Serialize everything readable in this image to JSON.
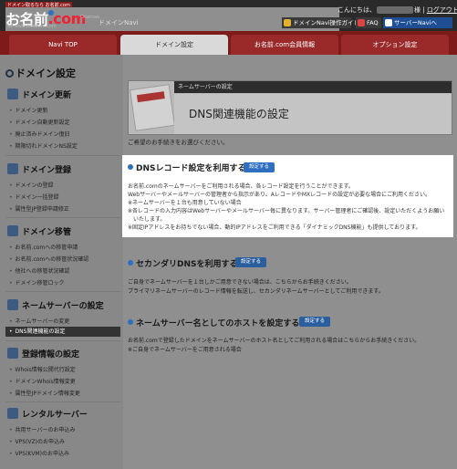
{
  "header": {
    "logo_tag": "ドメイン取るなら お名前.com",
    "logo_text": "お名前",
    "logo_suffix": ".com",
    "logo_url": "by www.onamae.com",
    "logo_tm": "Onamae",
    "navi_title": "ドメインNavi",
    "greeting": "こんにちは、",
    "greeting_suffix": "様",
    "logout": "ログアウト",
    "guide_btn": "ドメインNavi操作ガイド",
    "faq_btn": "FAQ",
    "server_btn": "サーバーNaviへ",
    "colors": {
      "brand_red": "#7d1a1a",
      "accent_blue": "#2f6fc0",
      "dark": "#2a2a2a"
    }
  },
  "tabs": [
    {
      "label": "Navi TOP"
    },
    {
      "label": "ドメイン設定"
    },
    {
      "label": "お名前.com会員情報"
    },
    {
      "label": "オプション設定"
    }
  ],
  "sidebar": {
    "title": "ドメイン設定",
    "sections": [
      {
        "label": "ドメイン更新",
        "icon": "refresh-icon",
        "items": [
          "ドメイン更新",
          "ドメイン自動更新設定",
          "廃止済みドメイン復旧",
          "期限切れドメインNS設定"
        ]
      },
      {
        "label": "ドメイン登録",
        "icon": "plus-icon",
        "items": [
          "ドメインの登録",
          "ドメイン一括登録",
          "属性型JP登録申請修正"
        ]
      },
      {
        "label": "ドメイン移管",
        "icon": "transfer-icon",
        "items": [
          "お名前.comへの移管申請",
          "お名前.comへの移管状況確認",
          "他社への移管状況確認",
          "ドメイン移管ロック"
        ]
      },
      {
        "label": "ネームサーバーの設定",
        "icon": "server-icon",
        "items": [
          "ネームサーバーの変更",
          "DNS関連機能の設定"
        ]
      },
      {
        "label": "登録情報の設定",
        "icon": "info-icon",
        "items": [
          "Whois情報公開代行設定",
          "ドメインWhois情報変更",
          "属性型JPドメイン情報変更"
        ]
      },
      {
        "label": "レンタルサーバー",
        "icon": "rack-icon",
        "items": [
          "共用サーバーのお申込み",
          "VPS(VZ)のお申込み",
          "VPS(KVM)のお申込み"
        ]
      }
    ]
  },
  "main": {
    "band": "ネームサーバーの設定",
    "title": "DNS関連機能の設定",
    "intro": "ご希望のお手続きをお選びください。",
    "set_label": "設定する",
    "dns_record": {
      "heading": "DNSレコード設定を利用する",
      "lines": [
        "お名前.comのネームサーバーをご利用される場合、各レコード設定を行うことができます。",
        "Webサーバーやメールサーバーの管理者から指示があり、AレコードやMXレコードの設定が必要な場合にご利用ください。",
        "※ネームサーバーを１台も用意していない場合",
        "※各レコードの入力内容はWebサーバーやメールサーバー毎に異なります。サーバー管理者にご確認後、設定いただくようお願い",
        "　いたします。",
        "※固定IPアドレスをお持ちでない場合、動的IPアドレスをご利用できる「ダイナミックDNS機能」も提供しております。"
      ]
    },
    "secondary_dns": {
      "heading": "セカンダリDNSを利用する",
      "lines": [
        "ご自身でネームサーバーを１台しかご用意できない場合は、こちらからお手続きください。",
        "プライマリネームサーバーのレコード情報を転送し、セカンダリネームサーバーとしてご利用できます。"
      ]
    },
    "host": {
      "heading": "ネームサーバー名としてのホストを設定する",
      "lines": [
        "お名前.comで登録したドメインをネームサーバーのホスト名としてご利用される場合はこちらからお手続きください。",
        "※ご自身でネームサーバーをご用意される場合"
      ]
    }
  }
}
